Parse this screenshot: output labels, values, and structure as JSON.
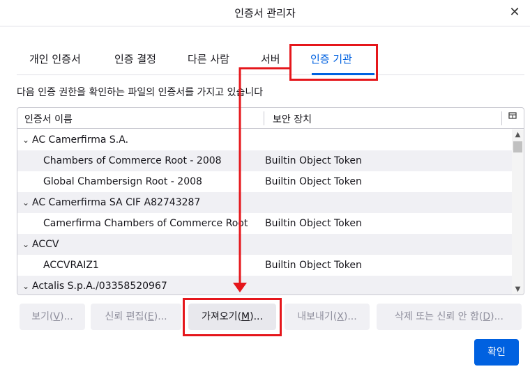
{
  "window": {
    "title": "인증서 관리자",
    "close_symbol": "✕"
  },
  "tabs": [
    {
      "label": "개인 인증서",
      "selected": false
    },
    {
      "label": "인증 결정",
      "selected": false
    },
    {
      "label": "다른 사람",
      "selected": false
    },
    {
      "label": "서버",
      "selected": false
    },
    {
      "label": "인증 기관",
      "selected": true
    }
  ],
  "description": "다음 인증 권한을 확인하는 파일의 인증서를 가지고 있습니다",
  "tree": {
    "columns": {
      "name": "인증서 이름",
      "device": "보안 장치",
      "picker_icon": "column-picker-icon"
    },
    "rows": [
      {
        "type": "group",
        "name": "AC Camerfirma S.A.",
        "device": ""
      },
      {
        "type": "cert",
        "name": "Chambers of Commerce Root - 2008",
        "device": "Builtin Object Token"
      },
      {
        "type": "cert",
        "name": "Global Chambersign Root - 2008",
        "device": "Builtin Object Token"
      },
      {
        "type": "group",
        "name": "AC Camerfirma SA CIF A82743287",
        "device": ""
      },
      {
        "type": "cert",
        "name": "Camerfirma Chambers of Commerce Root",
        "device": "Builtin Object Token"
      },
      {
        "type": "group",
        "name": "ACCV",
        "device": ""
      },
      {
        "type": "cert",
        "name": "ACCVRAIZ1",
        "device": "Builtin Object Token"
      },
      {
        "type": "group",
        "name": "Actalis S.p.A./03358520967",
        "device": ""
      }
    ]
  },
  "buttons": {
    "view": {
      "text": "보기(",
      "key": "V",
      "suffix": ")..."
    },
    "edit": {
      "text": "신뢰 편집(",
      "key": "E",
      "suffix": ")..."
    },
    "import": {
      "text": "가져오기(",
      "key": "M",
      "suffix": ")..."
    },
    "export": {
      "text": "내보내기(",
      "key": "X",
      "suffix": ")..."
    },
    "delete": {
      "text": "삭제 또는 신뢰 안 함(",
      "key": "D",
      "suffix": ")..."
    },
    "ok": "확인"
  },
  "colors": {
    "accent": "#0061e0",
    "highlight": "#e5161b"
  }
}
